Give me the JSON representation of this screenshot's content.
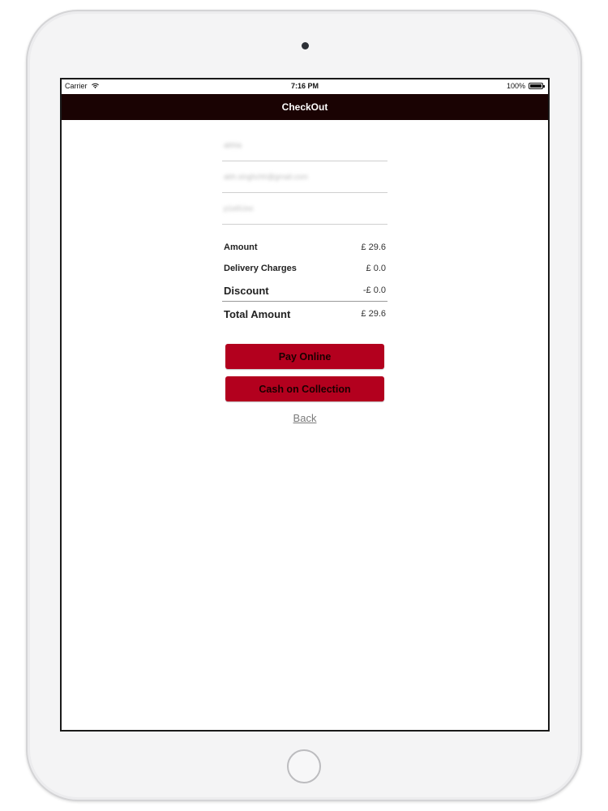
{
  "status_bar": {
    "carrier": "Carrier",
    "time": "7:16 PM",
    "battery": "100%",
    "battery_level": 1.0
  },
  "nav": {
    "title": "CheckOut"
  },
  "form": {
    "name_value": "abhia",
    "email_value": "abh.singhchh@gmail.com",
    "postcode_value": "p1e6Uoo"
  },
  "totals": {
    "amount_label": "Amount",
    "amount_value": "£ 29.6",
    "delivery_label": "Delivery Charges",
    "delivery_value": "£ 0.0",
    "discount_label": "Discount",
    "discount_value": "-£ 0.0",
    "total_label": "Total Amount",
    "total_value": "£ 29.6"
  },
  "actions": {
    "pay_online": "Pay Online",
    "cash_on_collection": "Cash on Collection",
    "back": "Back"
  },
  "colors": {
    "nav_background": "#1a0303",
    "button_red": "#b3001e"
  },
  "icons": {
    "wifi": "wifi-icon",
    "battery": "battery-icon",
    "camera": "camera-icon",
    "home": "home-button-icon"
  }
}
